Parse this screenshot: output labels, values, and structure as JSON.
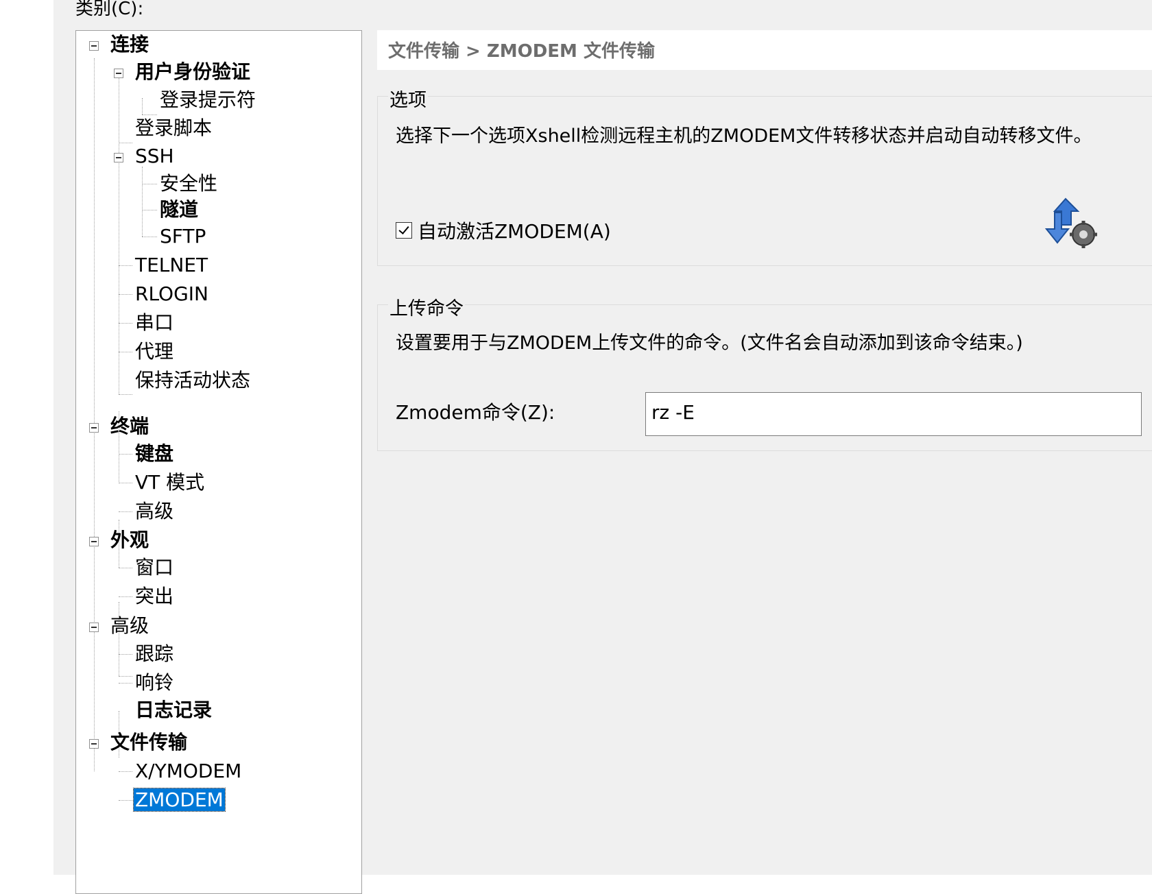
{
  "category_label": "类别(C):",
  "tree": [
    {
      "label": "连接",
      "bold": true
    },
    {
      "label": "用户身份验证",
      "bold": true
    },
    {
      "label": "登录提示符",
      "bold": false
    },
    {
      "label": "登录脚本",
      "bold": false
    },
    {
      "label": "SSH",
      "bold": false
    },
    {
      "label": "安全性",
      "bold": false
    },
    {
      "label": "隧道",
      "bold": true
    },
    {
      "label": "SFTP",
      "bold": false
    },
    {
      "label": "TELNET",
      "bold": false
    },
    {
      "label": "RLOGIN",
      "bold": false
    },
    {
      "label": "串口",
      "bold": false
    },
    {
      "label": "代理",
      "bold": false
    },
    {
      "label": "保持活动状态",
      "bold": false
    },
    {
      "label": "终端",
      "bold": true
    },
    {
      "label": "键盘",
      "bold": true
    },
    {
      "label": "VT 模式",
      "bold": false
    },
    {
      "label": "高级",
      "bold": false
    },
    {
      "label": "外观",
      "bold": true
    },
    {
      "label": "窗口",
      "bold": false
    },
    {
      "label": "突出",
      "bold": false
    },
    {
      "label": "高级",
      "bold": false
    },
    {
      "label": "跟踪",
      "bold": false
    },
    {
      "label": "响铃",
      "bold": false
    },
    {
      "label": "日志记录",
      "bold": true
    },
    {
      "label": "文件传输",
      "bold": true
    },
    {
      "label": "X/YMODEM",
      "bold": false
    },
    {
      "label": "ZMODEM",
      "bold": false,
      "selected": true
    }
  ],
  "breadcrumb": "文件传输 > ZMODEM 文件传输",
  "options": {
    "title": "选项",
    "description": "选择下一个选项Xshell检测远程主机的ZMODEM文件转移状态并启动自动转移文件。",
    "auto_activate_label": "自动激活ZMODEM(A)",
    "auto_activate_checked": true,
    "icon": "transfer-gear-icon"
  },
  "upload": {
    "title": "上传命令",
    "description": "设置要用于与ZMODEM上传文件的命令。(文件名会自动添加到该命令结束。)",
    "cmd_label": "Zmodem命令(Z):",
    "cmd_value": "rz -E"
  },
  "colors": {
    "selection": "#0078d7",
    "dialog_bg": "#f0f0f0",
    "icon_blue": "#2f6fc9"
  }
}
